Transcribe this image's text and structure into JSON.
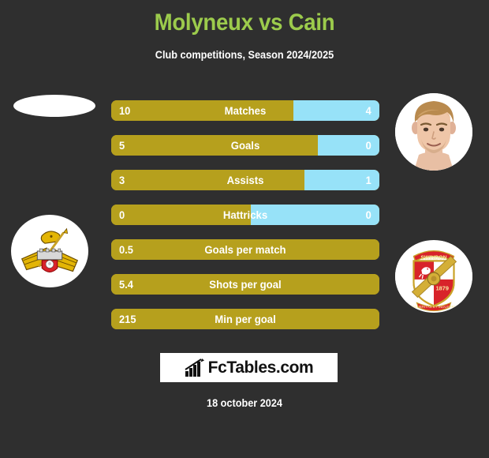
{
  "header": {
    "title": "Molyneux vs Cain",
    "subtitle": "Club competitions, Season 2024/2025",
    "title_color": "#9CCB4C"
  },
  "colors": {
    "background": "#2f2f2f",
    "left_bar": "#B6A01D",
    "right_bar": "#97E2F8",
    "text": "#ffffff"
  },
  "left_player": {
    "photo": "missing-player-photo",
    "club_crest": "doncaster-rovers-crest"
  },
  "right_player": {
    "photo": "player-photo",
    "club_crest": "swindon-town-crest"
  },
  "footer": {
    "logo_text": "FcTables.com",
    "logo_icon": "bar-chart-arrow-icon",
    "date": "18 october 2024"
  },
  "chart_data": {
    "type": "bar",
    "title": "Molyneux vs Cain",
    "subtitle": "Club competitions, Season 2024/2025",
    "xlabel": "",
    "ylabel": "",
    "orientation": "horizontal-diverging",
    "legend": [
      "Molyneux",
      "Cain"
    ],
    "categories": [
      "Matches",
      "Goals",
      "Assists",
      "Hattricks",
      "Goals per match",
      "Shots per goal",
      "Min per goal"
    ],
    "series": [
      {
        "name": "Molyneux",
        "color": "#B6A01D",
        "values": [
          "10",
          "5",
          "3",
          "0",
          "0.5",
          "5.4",
          "215"
        ]
      },
      {
        "name": "Cain",
        "color": "#97E2F8",
        "values": [
          "4",
          "0",
          "1",
          "0",
          null,
          null,
          null
        ]
      }
    ],
    "rows": [
      {
        "label": "Matches",
        "left": "10",
        "right": "4",
        "left_pct": 68,
        "two_sided": true
      },
      {
        "label": "Goals",
        "left": "5",
        "right": "0",
        "left_pct": 77,
        "two_sided": true
      },
      {
        "label": "Assists",
        "left": "3",
        "right": "1",
        "left_pct": 72,
        "two_sided": true
      },
      {
        "label": "Hattricks",
        "left": "0",
        "right": "0",
        "left_pct": 52,
        "two_sided": true
      },
      {
        "label": "Goals per match",
        "left": "0.5",
        "right": "",
        "left_pct": 100,
        "two_sided": false
      },
      {
        "label": "Shots per goal",
        "left": "5.4",
        "right": "",
        "left_pct": 100,
        "two_sided": false
      },
      {
        "label": "Min per goal",
        "left": "215",
        "right": "",
        "left_pct": 100,
        "two_sided": false
      }
    ]
  }
}
